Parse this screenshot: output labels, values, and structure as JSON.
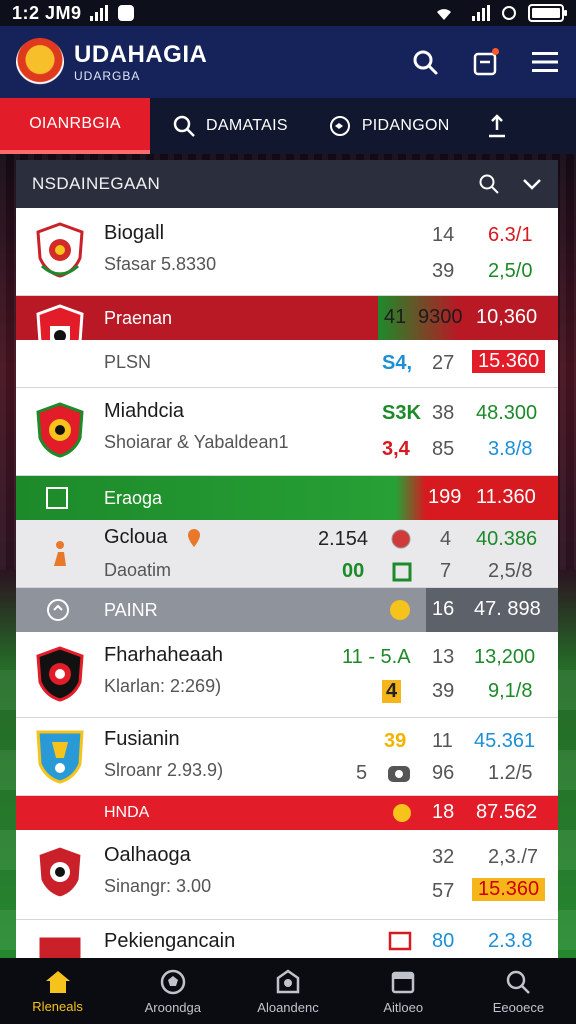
{
  "status_bar": {
    "time": "1:2 JM9"
  },
  "header": {
    "title": "UDAHAGIA",
    "subtitle": "UDARGBA"
  },
  "tabs": [
    {
      "label": "OIANRBGIA"
    },
    {
      "label": "DAMATAIS"
    },
    {
      "label": "PIDANGON"
    }
  ],
  "panel": {
    "title": "NSDAINEGAAN"
  },
  "rows": [
    {
      "name": "Biogall",
      "sub": "Sfasar 5.8330",
      "v1": "14",
      "v2": "6.3/1",
      "v3": "39",
      "v4": "2,5/0"
    },
    {
      "bar": "Praenan",
      "bar_v1": "41",
      "bar_v2": "9300",
      "bar_v3": "10,360",
      "sub": "PLSN",
      "v1": "S4,",
      "v2": "27",
      "v3": "15.360"
    },
    {
      "name": "Miahdcia",
      "sub": "Shoiarar & Yabaldean1",
      "v1": "S3K",
      "v2": "38",
      "v3": "48.300",
      "v4": "3,4",
      "v5": "85",
      "v6": "3.8/8"
    },
    {
      "bar": "Eraoga",
      "bar_v1": "199",
      "bar_v2": "11.360"
    },
    {
      "name": "Gcloua",
      "sub": "Daoatim",
      "v1": "2.154",
      "v2": "4",
      "v3": "40.386",
      "v4": "00",
      "v5": "7",
      "v6": "2,5/8"
    },
    {
      "bar": "PAINR",
      "bar_v1": "16",
      "bar_v2": "47. 898"
    },
    {
      "name": "Fharhaheaah",
      "sub": "Klarlan: 2:269)",
      "v1": "11 - 5.A",
      "v2": "13",
      "v3": "13,200",
      "v4": "4",
      "v5": "39",
      "v6": "9,1/8"
    },
    {
      "name": "Fusianin",
      "sub": "Slroanr 2.93.9)",
      "v1": "39",
      "v2": "11",
      "v3": "45.361",
      "v4": "5",
      "v5": "96",
      "v6": "1.2/5"
    },
    {
      "bar": "HNDA",
      "bar_v1": "18",
      "bar_v2": "87.562"
    },
    {
      "name": "Oalhaoga",
      "sub": "Sinangr: 3.00",
      "v1": "32",
      "v2": "2,3./7",
      "v3": "57",
      "v4": "15.360"
    },
    {
      "name": "Pekiengancain",
      "v1": "80",
      "v2": "2.3.8"
    }
  ],
  "bottom_nav": [
    {
      "label": "Rleneals"
    },
    {
      "label": "Aroondga"
    },
    {
      "label": "Aloandenc"
    },
    {
      "label": "Aitloeo"
    },
    {
      "label": "Eeooece"
    }
  ],
  "colors": {
    "brand_navy": "#16235a",
    "accent_red": "#e21c28",
    "accent_green": "#1d8a2a",
    "nav_active": "#f6c21c"
  }
}
